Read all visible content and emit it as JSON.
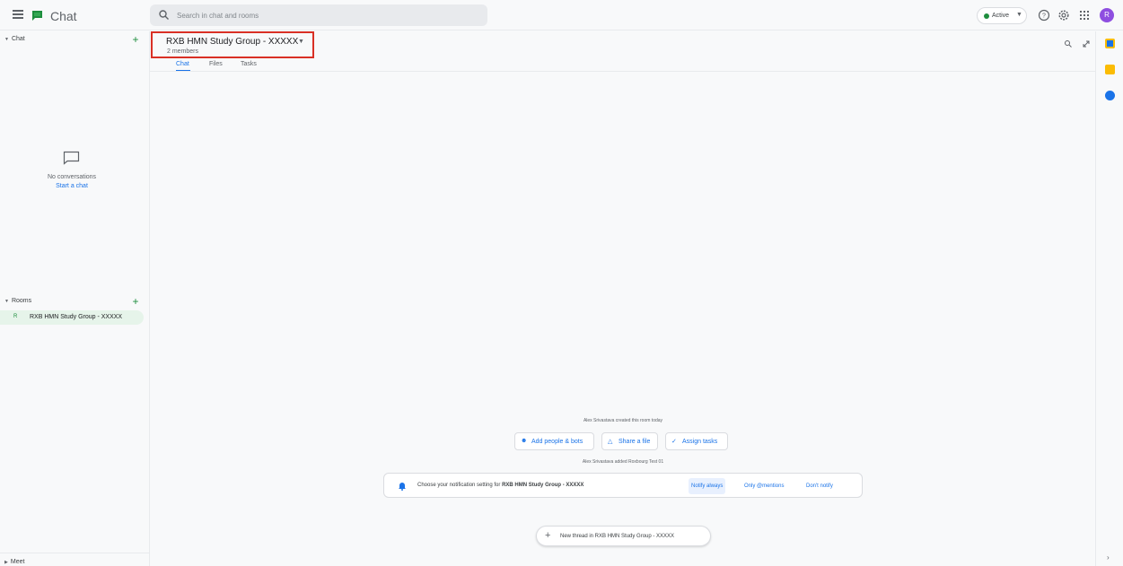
{
  "header": {
    "app_title": "Chat",
    "search_placeholder": "Search in chat and rooms",
    "status_label": "Active",
    "avatar_initial": "R",
    "icons": [
      "menu-icon",
      "chat-logo-icon",
      "search-icon",
      "help-icon",
      "settings-icon",
      "apps-grid-icon"
    ]
  },
  "sidebar": {
    "chat_section_label": "Chat",
    "no_conversations": "No conversations",
    "start_chat": "Start a chat",
    "rooms_section_label": "Rooms",
    "rooms": [
      {
        "initial": "R",
        "label": "RXB HMN Study Group - XXXXX"
      }
    ],
    "meet_section_label": "Meet"
  },
  "room": {
    "title": "RXB HMN Study Group - XXXXX",
    "members": "2 members",
    "tabs": [
      "Chat",
      "Files",
      "Tasks"
    ],
    "active_tab": "Chat"
  },
  "timeline": {
    "created_msg": "Alex Srivastava created this room today",
    "actions": {
      "add_people": "Add people & bots",
      "share_file": "Share a file",
      "assign_tasks": "Assign tasks"
    },
    "added_msg": "Alex Srivastava added Roxbourg Test 01",
    "notify": {
      "prefix": "Choose your notification setting for ",
      "room": "RXB HMN Study Group - XXXXX",
      "options": [
        "Notify always",
        "Only @mentions",
        "Don't notify"
      ],
      "selected": "Notify always"
    },
    "new_thread": "New thread in RXB HMN Study Group - XXXXX"
  },
  "colors": {
    "accent": "#1a73e8",
    "green": "#1e8e3e",
    "highlight_border": "#d93025",
    "avatar": "#8e4ee0"
  }
}
